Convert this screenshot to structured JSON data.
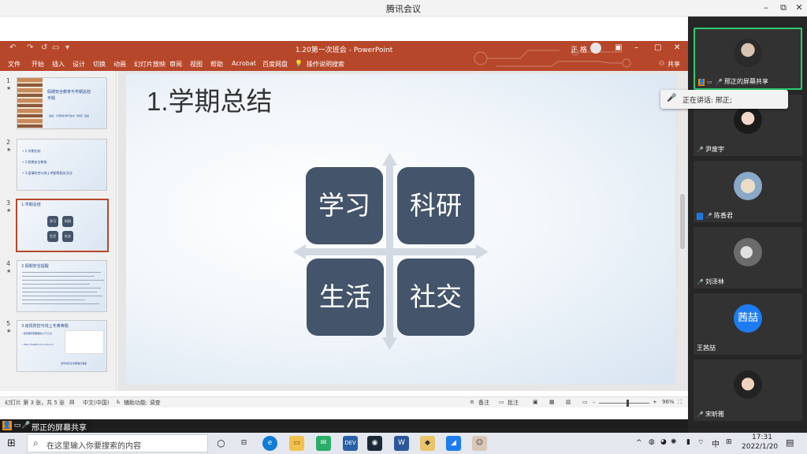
{
  "meeting": {
    "title": "腾讯会议",
    "share_banner": "邢正的屏幕共享",
    "tooltip": "正在讲话: 邢正;"
  },
  "powerpoint": {
    "title": "1.20第一次班会 - PowerPoint",
    "user": "正 格",
    "share_label": "共享",
    "menu": [
      "文件",
      "开始",
      "插入",
      "设计",
      "切换",
      "动画",
      "幻灯片放映",
      "审阅",
      "视图",
      "帮助",
      "Acrobat",
      "百度网盘",
      "操作说明搜索"
    ],
    "thumbnails": [
      {
        "num": "1",
        "lines": [
          "假期安全教育与学期总结",
          "专题",
          "班级：计算机科学与技术（师范）班级"
        ]
      },
      {
        "num": "2",
        "lines": [
          "• 1.学期总结",
          "• 2.假期安全教育",
          "• 3.疫情防控与线上考勤等相关活动"
        ]
      },
      {
        "num": "3",
        "lines": [
          "1.学期总结"
        ],
        "tiles": [
          "学习",
          "科研",
          "生活",
          "社交"
        ]
      },
      {
        "num": "4",
        "lines": [
          "2.假期安全提醒"
        ]
      },
      {
        "num": "5",
        "lines": [
          "3.疫情防控与线上冬奥等题",
          "• 疫情期间需要做好以下几点：",
          "• http://health.lnnu.edu.cn/",
          "百年校庆全市都做好准备"
        ]
      }
    ],
    "slide": {
      "title": "1.学期总结",
      "tiles": [
        "学习",
        "科研",
        "生活",
        "社交"
      ]
    },
    "status": {
      "slide_info": "幻灯片 第 3 张，共 5 张",
      "language": "中文(中国)",
      "accessibility": "辅助功能: 调查",
      "notes": "备注",
      "comments": "批注",
      "zoom": "96%"
    },
    "accent_color": "#b7472a",
    "tile_color": "#44546a"
  },
  "participants": [
    {
      "name": "邢正的屏幕共享",
      "active": true,
      "photo": "person-dark",
      "icons": [
        "user-icon",
        "screen-icon",
        "mic-icon"
      ]
    },
    {
      "name": "尹废宇",
      "active": false,
      "photo": "person-light",
      "icons": [
        "mic-icon"
      ]
    },
    {
      "name": "陈香君",
      "active": false,
      "photo": "cat",
      "icons": [
        "user-icon",
        "mic-icon"
      ]
    },
    {
      "name": "刘泽林",
      "active": false,
      "photo": "animal",
      "icons": [
        "mic-icon"
      ]
    },
    {
      "name": "王茜喆",
      "active": false,
      "avatar_text": "茜喆",
      "icons": []
    },
    {
      "name": "宋昕雅",
      "active": false,
      "photo": "person-face",
      "icons": [
        "mic-icon"
      ]
    }
  ],
  "taskbar": {
    "search_placeholder": "在这里输入你要搜索的内容",
    "ime": "中",
    "time": "17:31",
    "date": "2022/1/20"
  }
}
